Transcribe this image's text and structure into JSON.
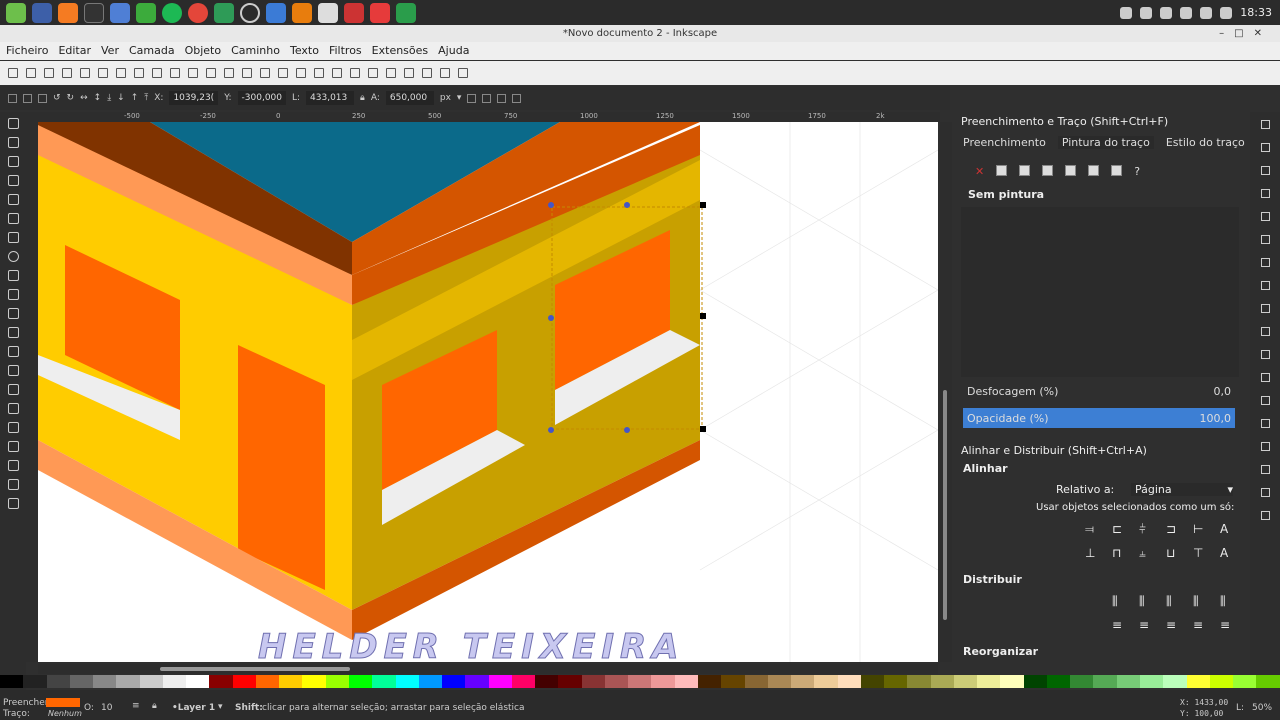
{
  "topbar": {
    "clock": "18:33"
  },
  "window": {
    "title": "*Novo documento 2 - Inkscape"
  },
  "menu": [
    "Ficheiro",
    "Editar",
    "Ver",
    "Camada",
    "Objeto",
    "Caminho",
    "Texto",
    "Filtros",
    "Extensões",
    "Ajuda"
  ],
  "toolctl": {
    "x_label": "X:",
    "x": "1039,23(",
    "y_label": "Y:",
    "y": "-300,000",
    "w_label": "L:",
    "w": "433,013",
    "h_label": "A:",
    "h": "650,000",
    "unit": "px"
  },
  "ruler": [
    "-500",
    "-250",
    "0",
    "250",
    "500",
    "750",
    "1000",
    "1250",
    "1500",
    "1750",
    "2k"
  ],
  "canvas": {
    "watermark": "HELDER TEIXEIRA",
    "colors": {
      "top": "#0b6a8a",
      "yellow": "#ffcc00",
      "darkyellow": "#c8a000",
      "orange": "#ff6600",
      "darkorange": "#d45500",
      "brown": "#803300",
      "lightorange": "#ff9955"
    }
  },
  "fill_stroke": {
    "title": "Preenchimento e Traço (Shift+Ctrl+F)",
    "tabs": [
      "Preenchimento",
      "Pintura do traço",
      "Estilo do traço"
    ],
    "paint": "Sem pintura",
    "blur_label": "Desfocagem (%)",
    "blur": "0,0",
    "opacity_label": "Opacidade (%)",
    "opacity": "100,0"
  },
  "align": {
    "title": "Alinhar e Distribuir (Shift+Ctrl+A)",
    "section_align": "Alinhar",
    "relative_label": "Relativo a:",
    "relative": "Página",
    "group_label": "Usar objetos selecionados como um só:",
    "section_distribute": "Distribuir",
    "section_rearrange": "Reorganizar"
  },
  "status": {
    "fill_label": "Preencher:",
    "stroke_label": "Traço:",
    "stroke": "Nenhum",
    "fill_color": "#ff6600",
    "opacity_label": "O:",
    "opacity": "10",
    "layer": "•Layer 1",
    "message_key": "Shift:",
    "message": " clicar para alternar seleção; arrastar para seleção elástica",
    "cursor_x": "X: 1433,00",
    "cursor_y": "Y:  100,00",
    "zoom_label": "L:",
    "zoom": "50%"
  }
}
